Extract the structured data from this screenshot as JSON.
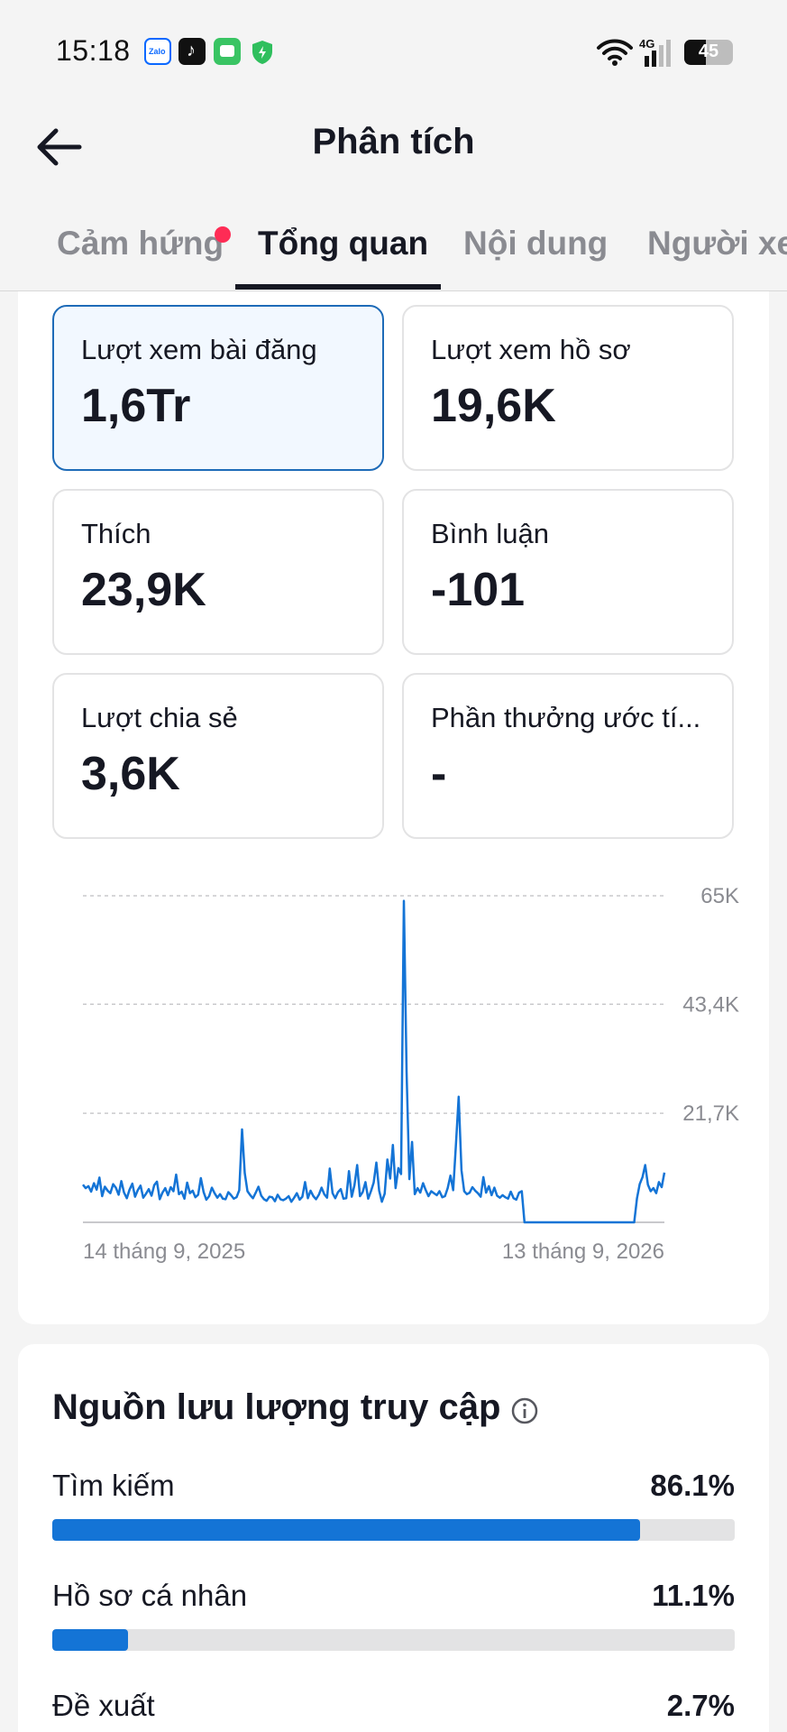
{
  "status_bar": {
    "time": "15:18",
    "apps": [
      "zalo-icon",
      "tiktok-icon",
      "messages-icon",
      "shield-icon"
    ],
    "zalo_text": "Zalo",
    "network": "4G",
    "battery": "45"
  },
  "header": {
    "title": "Phân tích"
  },
  "tabs": [
    {
      "label": "Cảm hứng",
      "active": false,
      "badge": true
    },
    {
      "label": "Tổng quan",
      "active": true
    },
    {
      "label": "Nội dung",
      "active": false
    },
    {
      "label": "Người xem",
      "active": false
    }
  ],
  "metrics": [
    {
      "label": "Lượt xem bài đăng",
      "value": "1,6Tr",
      "selected": true
    },
    {
      "label": "Lượt xem hồ sơ",
      "value": "19,6K"
    },
    {
      "label": "Thích",
      "value": "23,9K"
    },
    {
      "label": "Bình luận",
      "value": "-101"
    },
    {
      "label": "Lượt chia sẻ",
      "value": "3,6K"
    },
    {
      "label": "Phần thưởng ước tí...",
      "value": "-"
    }
  ],
  "chart_data": {
    "type": "line",
    "y_ticks": [
      "65K",
      "43,4K",
      "21,7K"
    ],
    "y_tick_values": [
      65000,
      43400,
      21700
    ],
    "ylim": [
      0,
      65000
    ],
    "x_start_label": "14 tháng 9, 2025",
    "x_end_label": "13 tháng 9, 2026",
    "grid": "dashed-horizontal",
    "color": "#1474d6",
    "series": [
      {
        "values": [
          7500,
          6800,
          7200,
          6100,
          7800,
          6500,
          8900,
          5200,
          7100,
          6300,
          5800,
          7600,
          6900,
          5500,
          8200,
          5900,
          4800,
          6500,
          7700,
          5100,
          6400,
          7300,
          4900,
          5700,
          6600,
          5300,
          7400,
          8100,
          4600,
          5900,
          6800,
          5400,
          7000,
          6200,
          9500,
          5600,
          6100,
          4700,
          7900,
          5800,
          6300,
          5000,
          5500,
          8800,
          6000,
          4500,
          5200,
          6900,
          5800,
          4900,
          5600,
          4700,
          4600,
          6000,
          5400,
          4700,
          5000,
          6400,
          18500,
          9800,
          6200,
          5400,
          4800,
          5900,
          7100,
          5300,
          4600,
          4300,
          5100,
          5000,
          4200,
          5500,
          4600,
          4400,
          4700,
          5200,
          4100,
          4900,
          5800,
          4500,
          5100,
          8000,
          4800,
          6300,
          5200,
          4600,
          5500,
          6900,
          5600,
          4900,
          10700,
          5800,
          4800,
          6000,
          6600,
          4700,
          4800,
          10200,
          5100,
          7400,
          11400,
          5200,
          6000,
          8000,
          4700,
          6200,
          7900,
          11900,
          6300,
          4100,
          5700,
          12500,
          8700,
          15400,
          6800,
          10800,
          9600,
          64000,
          30000,
          8600,
          16000,
          5600,
          6800,
          5900,
          7800,
          6400,
          5200,
          6200,
          5800,
          5400,
          6200,
          5000,
          5200,
          6800,
          9300,
          6400,
          15600,
          25000,
          10400,
          6200,
          5600,
          5900,
          7000,
          6300,
          5800,
          5100,
          9000,
          5900,
          7200,
          5400,
          6900,
          5300,
          4900,
          5400,
          5000,
          4700,
          6100,
          4800,
          4500,
          5900,
          6200,
          0,
          0,
          0,
          0,
          0,
          0,
          0,
          0,
          0,
          0,
          0,
          0,
          0,
          0,
          0,
          0,
          0,
          0,
          0,
          0,
          0,
          0,
          0,
          0,
          0,
          0,
          0,
          0,
          0,
          0,
          0,
          0,
          0,
          0,
          0,
          0,
          0,
          0,
          0,
          0,
          0,
          4800,
          7600,
          9000,
          11400,
          7500,
          6200,
          6800,
          5800,
          8000,
          7000,
          9900
        ]
      }
    ]
  },
  "traffic": {
    "title": "Nguồn lưu lượng truy cập",
    "sources": [
      {
        "label": "Tìm kiếm",
        "percent": "86.1%",
        "value": 0.861
      },
      {
        "label": "Hồ sơ cá nhân",
        "percent": "11.1%",
        "value": 0.111
      },
      {
        "label": "Đề xuất",
        "percent": "2.7%",
        "value": 0.027
      }
    ]
  }
}
